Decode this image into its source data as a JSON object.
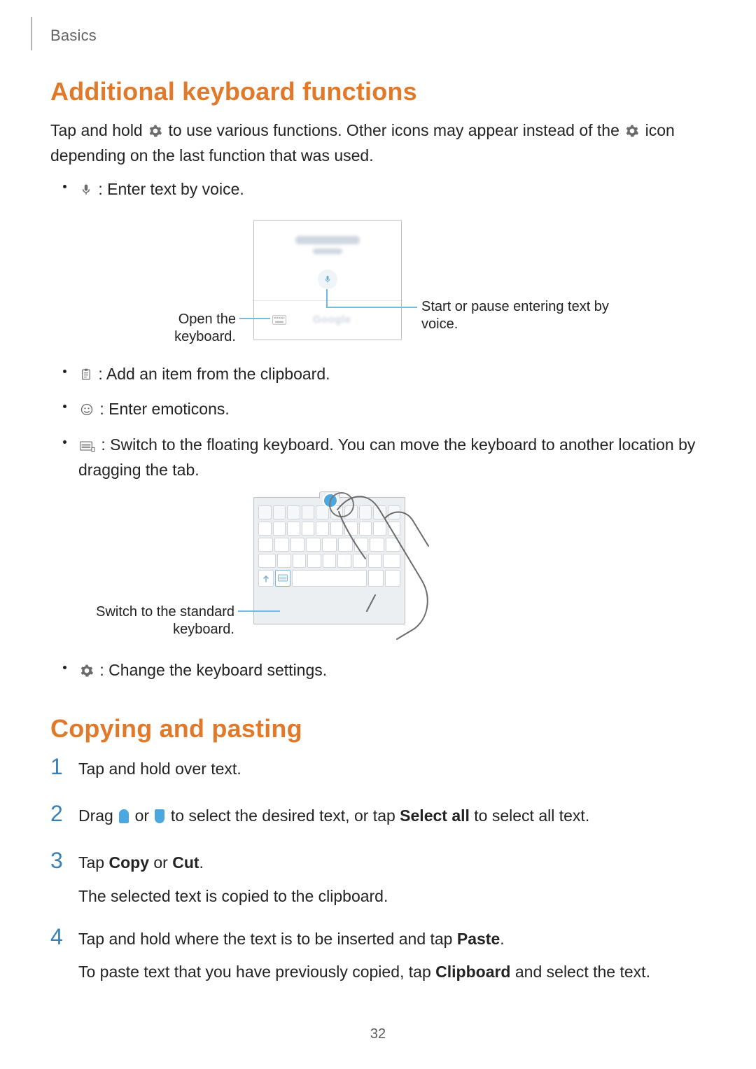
{
  "section_label": "Basics",
  "page_number": "32",
  "h1": "Additional keyboard functions",
  "intro_a": "Tap and hold ",
  "intro_b": " to use various functions. Other icons may appear instead of the ",
  "intro_c": " icon depending on the last function that was used.",
  "bullet_voice": " : Enter text by voice.",
  "callout_open_kbd": "Open the keyboard.",
  "callout_voice": "Start or pause entering text by voice.",
  "voice_brand_placeholder": "Google",
  "bullet_clipboard": " : Add an item from the clipboard.",
  "bullet_emoticons": " : Enter emoticons.",
  "bullet_floating": " : Switch to the floating keyboard. You can move the keyboard to another location by dragging the tab.",
  "callout_std_kbd": "Switch to the standard keyboard.",
  "bullet_settings": " : Change the keyboard settings.",
  "h2": "Copying and pasting",
  "steps": {
    "s1": "Tap and hold over text.",
    "s2_a": "Drag ",
    "s2_b": " or ",
    "s2_c": " to select the desired text, or tap ",
    "s2_d": "Select all",
    "s2_e": " to select all text.",
    "s3_a": "Tap ",
    "s3_b": "Copy",
    "s3_c": " or ",
    "s3_d": "Cut",
    "s3_e": ".",
    "s3_sub": "The selected text is copied to the clipboard.",
    "s4_a": "Tap and hold where the text is to be inserted and tap ",
    "s4_b": "Paste",
    "s4_c": ".",
    "s4_sub_a": "To paste text that you have previously copied, tap ",
    "s4_sub_b": "Clipboard",
    "s4_sub_c": " and select the text."
  }
}
